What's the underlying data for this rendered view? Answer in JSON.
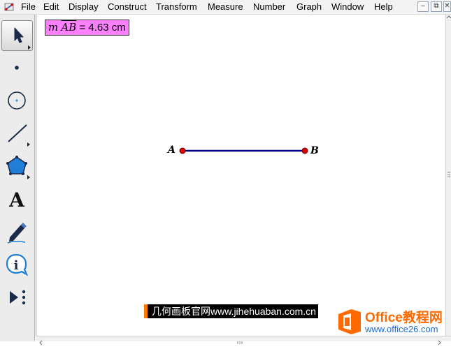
{
  "menubar": {
    "items": [
      "File",
      "Edit",
      "Display",
      "Construct",
      "Transform",
      "Measure",
      "Number",
      "Graph",
      "Window",
      "Help"
    ],
    "window_buttons": [
      "–",
      "⧉",
      "✕"
    ]
  },
  "toolbox": {
    "tools": [
      "selection-arrow",
      "point",
      "compass",
      "straightedge",
      "polygon",
      "text",
      "marker",
      "information",
      "custom-tools"
    ],
    "text_tool_glyph": "A",
    "info_glyph": "i"
  },
  "measurement": {
    "prefix": "m",
    "segment": "AB",
    "equals": "=",
    "value": "4.63",
    "unit": "cm"
  },
  "points": {
    "a_label": "A",
    "b_label": "B"
  },
  "colors": {
    "segment": "#000080",
    "point_fill": "#e00000",
    "measure_bg": "#ff80ff"
  },
  "watermark": {
    "site_text": "几何画板官网www.jihehuaban.com.cn",
    "office_title": "Office教程网",
    "office_url": "www.office26.com"
  }
}
